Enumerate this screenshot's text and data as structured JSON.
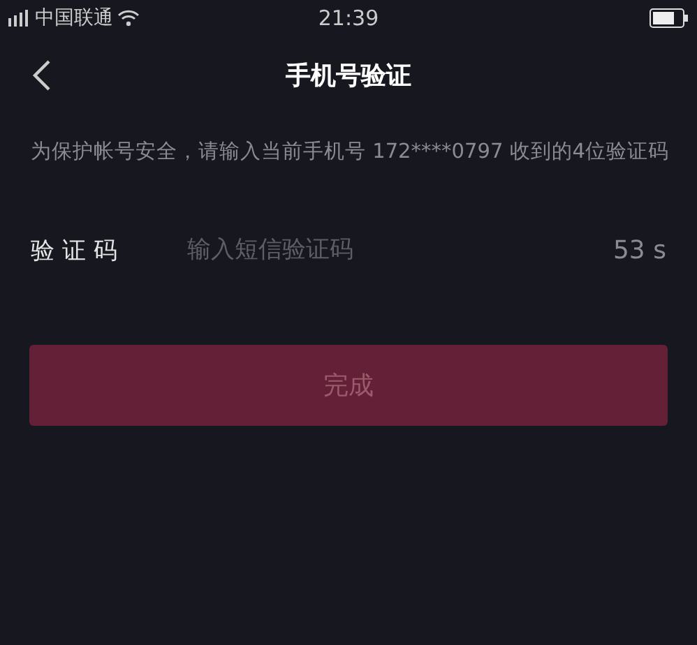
{
  "status_bar": {
    "carrier": "中国联通",
    "time": "21:39"
  },
  "nav": {
    "title": "手机号验证"
  },
  "description": "为保护帐号安全，请输入当前手机号 172****0797 收到的4位验证码",
  "code_field": {
    "label": "验 证 码",
    "placeholder": "输入短信验证码",
    "countdown": "53 s"
  },
  "submit": {
    "label": "完成",
    "disabled": true
  }
}
